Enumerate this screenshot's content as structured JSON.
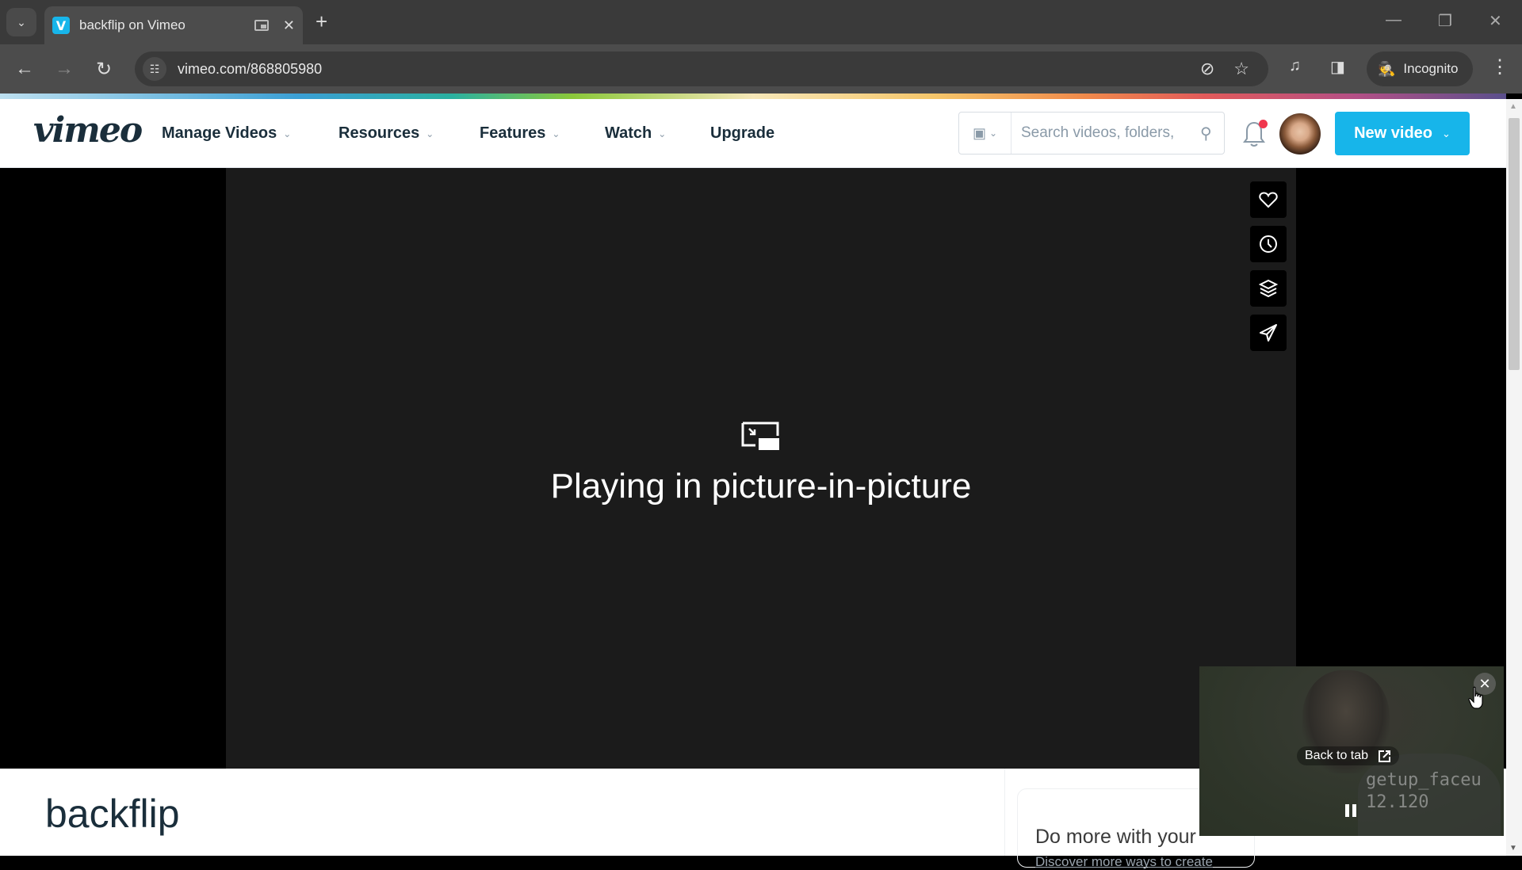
{
  "browser": {
    "tab": {
      "title": "backflip on Vimeo",
      "favicon": "V"
    },
    "url": "vimeo.com/868805980",
    "incognito_label": "Incognito",
    "icons": {
      "tab_search": "chevron-down-icon",
      "back": "back-arrow-icon",
      "forward": "forward-arrow-icon",
      "reload": "reload-icon",
      "site_info": "site-info-icon",
      "tracking_protection": "eye-slash-icon",
      "bookmark": "star-icon",
      "media_controls": "media-queue-icon",
      "side_panel": "side-panel-icon",
      "menu": "more-vert-icon"
    },
    "glyphs": {
      "tab_search": "⌄",
      "close": "✕",
      "new_tab": "+",
      "back": "←",
      "forward": "→",
      "reload": "↻",
      "site_info": "☷",
      "eye_slash": "⊘",
      "star": "☆",
      "media": "♫",
      "side_panel": "◨",
      "incognito": "🕵",
      "menu": "⋮",
      "minimize": "—",
      "restore": "❐",
      "window_close": "✕"
    }
  },
  "header": {
    "logo": "vimeo",
    "nav": [
      {
        "label": "Manage Videos",
        "has_dropdown": true
      },
      {
        "label": "Resources",
        "has_dropdown": true
      },
      {
        "label": "Features",
        "has_dropdown": true
      },
      {
        "label": "Watch",
        "has_dropdown": true
      },
      {
        "label": "Upgrade",
        "has_dropdown": false
      }
    ],
    "chevron": "⌄",
    "search": {
      "placeholder": "Search videos, folders,",
      "value": "",
      "type_icon": "▣",
      "search_glyph": "⚲"
    },
    "notification_dot": true,
    "new_video_label": "New video",
    "colors": {
      "brand": "#17b5ea",
      "text": "#1a2e3b",
      "notify": "#f0374e"
    }
  },
  "player": {
    "side_actions": [
      {
        "name": "like-button",
        "icon": "heart-icon"
      },
      {
        "name": "watch-later-button",
        "icon": "clock-icon"
      },
      {
        "name": "collections-button",
        "icon": "layers-icon"
      },
      {
        "name": "share-button",
        "icon": "send-icon"
      }
    ],
    "pip_message": "Playing in picture-in-picture"
  },
  "video": {
    "title": "backflip"
  },
  "promo": {
    "title": "Do more with your",
    "link": "Discover more ways to create"
  },
  "pip_window": {
    "back_to_tab_label": "Back to tab",
    "overlay_text": "getup_faceu\n12.120",
    "close_glyph": "✕",
    "state": "playing"
  }
}
